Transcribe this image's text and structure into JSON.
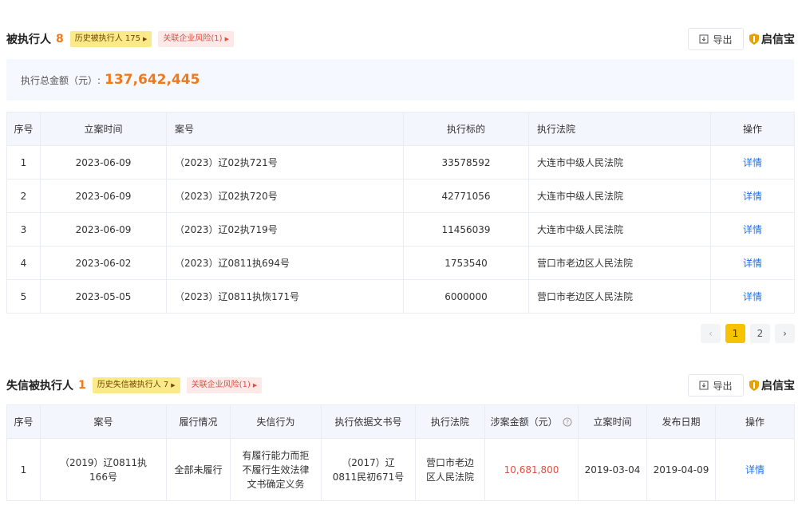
{
  "section1": {
    "title": "被执行人",
    "count": "8",
    "tag_history": "历史被执行人 175",
    "tag_related": "关联企业风险(1)",
    "export_label": "导出",
    "brand": "启信宝",
    "summary_label": "执行总金额（元）:",
    "summary_value": "137,642,445",
    "columns": [
      "序号",
      "立案时间",
      "案号",
      "执行标的",
      "执行法院",
      "操作"
    ],
    "rows": [
      {
        "no": "1",
        "date": "2023-06-09",
        "case_no": "（2023）辽02执721号",
        "amount": "33578592",
        "court": "大连市中级人民法院",
        "action": "详情"
      },
      {
        "no": "2",
        "date": "2023-06-09",
        "case_no": "（2023）辽02执720号",
        "amount": "42771056",
        "court": "大连市中级人民法院",
        "action": "详情"
      },
      {
        "no": "3",
        "date": "2023-06-09",
        "case_no": "（2023）辽02执719号",
        "amount": "11456039",
        "court": "大连市中级人民法院",
        "action": "详情"
      },
      {
        "no": "4",
        "date": "2023-06-02",
        "case_no": "（2023）辽0811执694号",
        "amount": "1753540",
        "court": "营口市老边区人民法院",
        "action": "详情"
      },
      {
        "no": "5",
        "date": "2023-05-05",
        "case_no": "（2023）辽0811执恢171号",
        "amount": "6000000",
        "court": "营口市老边区人民法院",
        "action": "详情"
      }
    ],
    "pagination": {
      "prev": "‹",
      "pages": [
        "1",
        "2"
      ],
      "current": "1",
      "next": "›"
    }
  },
  "section2": {
    "title": "失信被执行人",
    "count": "1",
    "tag_history": "历史失信被执行人 7",
    "tag_related": "关联企业风险(1)",
    "export_label": "导出",
    "brand": "启信宝",
    "columns": [
      "序号",
      "案号",
      "履行情况",
      "失信行为",
      "执行依据文书号",
      "执行法院",
      "涉案金额（元）",
      "立案时间",
      "发布日期",
      "操作"
    ],
    "rows": [
      {
        "no": "1",
        "case_no": "（2019）辽0811执166号",
        "status": "全部未履行",
        "behavior": "有履行能力而拒不履行生效法律文书确定义务",
        "basis_doc": "（2017）辽0811民初671号",
        "court": "营口市老边区人民法院",
        "amount": "10,681,800",
        "filing_date": "2019-03-04",
        "publish_date": "2019-04-09",
        "action": "详情"
      }
    ]
  },
  "colors": {
    "accent": "#f07a1b",
    "link": "#1f6feb",
    "risk": "#e24f44",
    "page_active": "#f7c300"
  }
}
